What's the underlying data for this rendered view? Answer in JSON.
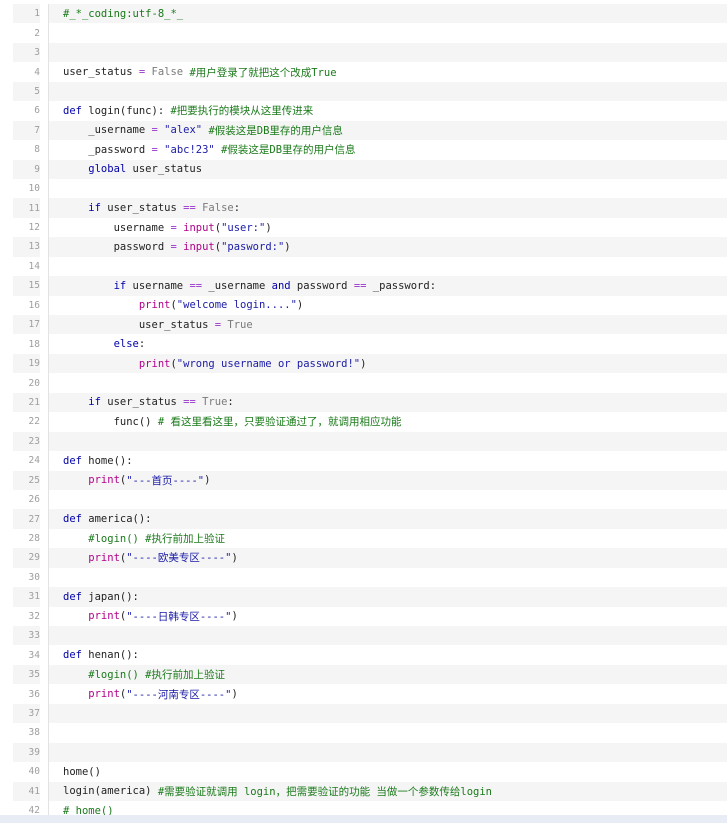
{
  "editor": {
    "lines": [
      {
        "n": "1",
        "t": [
          {
            "c": "cm",
            "s": "#_*_coding:utf-8_*_"
          }
        ]
      },
      {
        "n": "2",
        "t": []
      },
      {
        "n": "3",
        "t": []
      },
      {
        "n": "4",
        "t": [
          {
            "c": "",
            "s": "user_status "
          },
          {
            "c": "op",
            "s": "="
          },
          {
            "c": "",
            "s": " "
          },
          {
            "c": "cn",
            "s": "False"
          },
          {
            "c": "",
            "s": " "
          },
          {
            "c": "cm",
            "s": "#用户登录了就把这个改成True"
          }
        ]
      },
      {
        "n": "5",
        "t": []
      },
      {
        "n": "6",
        "t": [
          {
            "c": "kw",
            "s": "def"
          },
          {
            "c": "",
            "s": " login(func): "
          },
          {
            "c": "cm",
            "s": "#把要执行的模块从这里传进来"
          }
        ]
      },
      {
        "n": "7",
        "t": [
          {
            "c": "",
            "s": "    _username "
          },
          {
            "c": "op",
            "s": "="
          },
          {
            "c": "",
            "s": " "
          },
          {
            "c": "str",
            "s": "\"alex\""
          },
          {
            "c": "",
            "s": " "
          },
          {
            "c": "cm",
            "s": "#假装这是DB里存的用户信息"
          }
        ]
      },
      {
        "n": "8",
        "t": [
          {
            "c": "",
            "s": "    _password "
          },
          {
            "c": "op",
            "s": "="
          },
          {
            "c": "",
            "s": " "
          },
          {
            "c": "str",
            "s": "\"abc!23\""
          },
          {
            "c": "",
            "s": " "
          },
          {
            "c": "cm",
            "s": "#假装这是DB里存的用户信息"
          }
        ]
      },
      {
        "n": "9",
        "t": [
          {
            "c": "kw",
            "s": "    global"
          },
          {
            "c": "",
            "s": " user_status"
          }
        ]
      },
      {
        "n": "10",
        "t": []
      },
      {
        "n": "11",
        "t": [
          {
            "c": "kw",
            "s": "    if"
          },
          {
            "c": "",
            "s": " user_status "
          },
          {
            "c": "op",
            "s": "=="
          },
          {
            "c": "",
            "s": " "
          },
          {
            "c": "cn",
            "s": "False"
          },
          {
            "c": "",
            "s": ":"
          }
        ]
      },
      {
        "n": "12",
        "t": [
          {
            "c": "",
            "s": "        username "
          },
          {
            "c": "op",
            "s": "="
          },
          {
            "c": "",
            "s": " "
          },
          {
            "c": "bi",
            "s": "input"
          },
          {
            "c": "",
            "s": "("
          },
          {
            "c": "str",
            "s": "\"user:\""
          },
          {
            "c": "",
            "s": ")"
          }
        ]
      },
      {
        "n": "13",
        "t": [
          {
            "c": "",
            "s": "        password "
          },
          {
            "c": "op",
            "s": "="
          },
          {
            "c": "",
            "s": " "
          },
          {
            "c": "bi",
            "s": "input"
          },
          {
            "c": "",
            "s": "("
          },
          {
            "c": "str",
            "s": "\"pasword:\""
          },
          {
            "c": "",
            "s": ")"
          }
        ]
      },
      {
        "n": "14",
        "t": []
      },
      {
        "n": "15",
        "t": [
          {
            "c": "kw",
            "s": "        if"
          },
          {
            "c": "",
            "s": " username "
          },
          {
            "c": "op",
            "s": "=="
          },
          {
            "c": "",
            "s": " _username "
          },
          {
            "c": "kw",
            "s": "and"
          },
          {
            "c": "",
            "s": " password "
          },
          {
            "c": "op",
            "s": "=="
          },
          {
            "c": "",
            "s": " _password:"
          }
        ]
      },
      {
        "n": "16",
        "t": [
          {
            "c": "bi",
            "s": "            print"
          },
          {
            "c": "",
            "s": "("
          },
          {
            "c": "str",
            "s": "\"welcome login....\""
          },
          {
            "c": "",
            "s": ")"
          }
        ]
      },
      {
        "n": "17",
        "t": [
          {
            "c": "",
            "s": "            user_status "
          },
          {
            "c": "op",
            "s": "="
          },
          {
            "c": "",
            "s": " "
          },
          {
            "c": "cn",
            "s": "True"
          }
        ]
      },
      {
        "n": "18",
        "t": [
          {
            "c": "kw",
            "s": "        else"
          },
          {
            "c": "",
            "s": ":"
          }
        ]
      },
      {
        "n": "19",
        "t": [
          {
            "c": "bi",
            "s": "            print"
          },
          {
            "c": "",
            "s": "("
          },
          {
            "c": "str",
            "s": "\"wrong username or password!\""
          },
          {
            "c": "",
            "s": ")"
          }
        ]
      },
      {
        "n": "20",
        "t": []
      },
      {
        "n": "21",
        "t": [
          {
            "c": "kw",
            "s": "    if"
          },
          {
            "c": "",
            "s": " user_status "
          },
          {
            "c": "op",
            "s": "=="
          },
          {
            "c": "",
            "s": " "
          },
          {
            "c": "cn",
            "s": "True"
          },
          {
            "c": "",
            "s": ":"
          }
        ]
      },
      {
        "n": "22",
        "t": [
          {
            "c": "",
            "s": "        func() "
          },
          {
            "c": "cm",
            "s": "# 看这里看这里，只要验证通过了，就调用相应功能"
          }
        ]
      },
      {
        "n": "23",
        "t": []
      },
      {
        "n": "24",
        "t": [
          {
            "c": "kw",
            "s": "def"
          },
          {
            "c": "",
            "s": " home():"
          }
        ]
      },
      {
        "n": "25",
        "t": [
          {
            "c": "bi",
            "s": "    print"
          },
          {
            "c": "",
            "s": "("
          },
          {
            "c": "str",
            "s": "\"---首页----\""
          },
          {
            "c": "",
            "s": ")"
          }
        ]
      },
      {
        "n": "26",
        "t": []
      },
      {
        "n": "27",
        "t": [
          {
            "c": "kw",
            "s": "def"
          },
          {
            "c": "",
            "s": " america():"
          }
        ]
      },
      {
        "n": "28",
        "t": [
          {
            "c": "cm",
            "s": "    #login() #执行前加上验证"
          }
        ]
      },
      {
        "n": "29",
        "t": [
          {
            "c": "bi",
            "s": "    print"
          },
          {
            "c": "",
            "s": "("
          },
          {
            "c": "str",
            "s": "\"----欧美专区----\""
          },
          {
            "c": "",
            "s": ")"
          }
        ]
      },
      {
        "n": "30",
        "t": []
      },
      {
        "n": "31",
        "t": [
          {
            "c": "kw",
            "s": "def"
          },
          {
            "c": "",
            "s": " japan():"
          }
        ]
      },
      {
        "n": "32",
        "t": [
          {
            "c": "bi",
            "s": "    print"
          },
          {
            "c": "",
            "s": "("
          },
          {
            "c": "str",
            "s": "\"----日韩专区----\""
          },
          {
            "c": "",
            "s": ")"
          }
        ]
      },
      {
        "n": "33",
        "t": []
      },
      {
        "n": "34",
        "t": [
          {
            "c": "kw",
            "s": "def"
          },
          {
            "c": "",
            "s": " henan():"
          }
        ]
      },
      {
        "n": "35",
        "t": [
          {
            "c": "cm",
            "s": "    #login() #执行前加上验证"
          }
        ]
      },
      {
        "n": "36",
        "t": [
          {
            "c": "bi",
            "s": "    print"
          },
          {
            "c": "",
            "s": "("
          },
          {
            "c": "str",
            "s": "\"----河南专区----\""
          },
          {
            "c": "",
            "s": ")"
          }
        ]
      },
      {
        "n": "37",
        "t": []
      },
      {
        "n": "38",
        "t": []
      },
      {
        "n": "39",
        "t": []
      },
      {
        "n": "40",
        "t": [
          {
            "c": "",
            "s": "home()"
          }
        ]
      },
      {
        "n": "41",
        "t": [
          {
            "c": "",
            "s": "login(america) "
          },
          {
            "c": "cm",
            "s": "#需要验证就调用 login，把需要验证的功能 当做一个参数传给login"
          }
        ]
      },
      {
        "n": "42",
        "t": [
          {
            "c": "cm",
            "s": "# home()"
          }
        ]
      }
    ]
  },
  "colors": {
    "keyword": "#0000aa",
    "string": "#1a1aa6",
    "comment": "#1a7a1a",
    "builtin": "#b0008a",
    "operator": "#9933cc",
    "constant": "#7a7a7a"
  }
}
